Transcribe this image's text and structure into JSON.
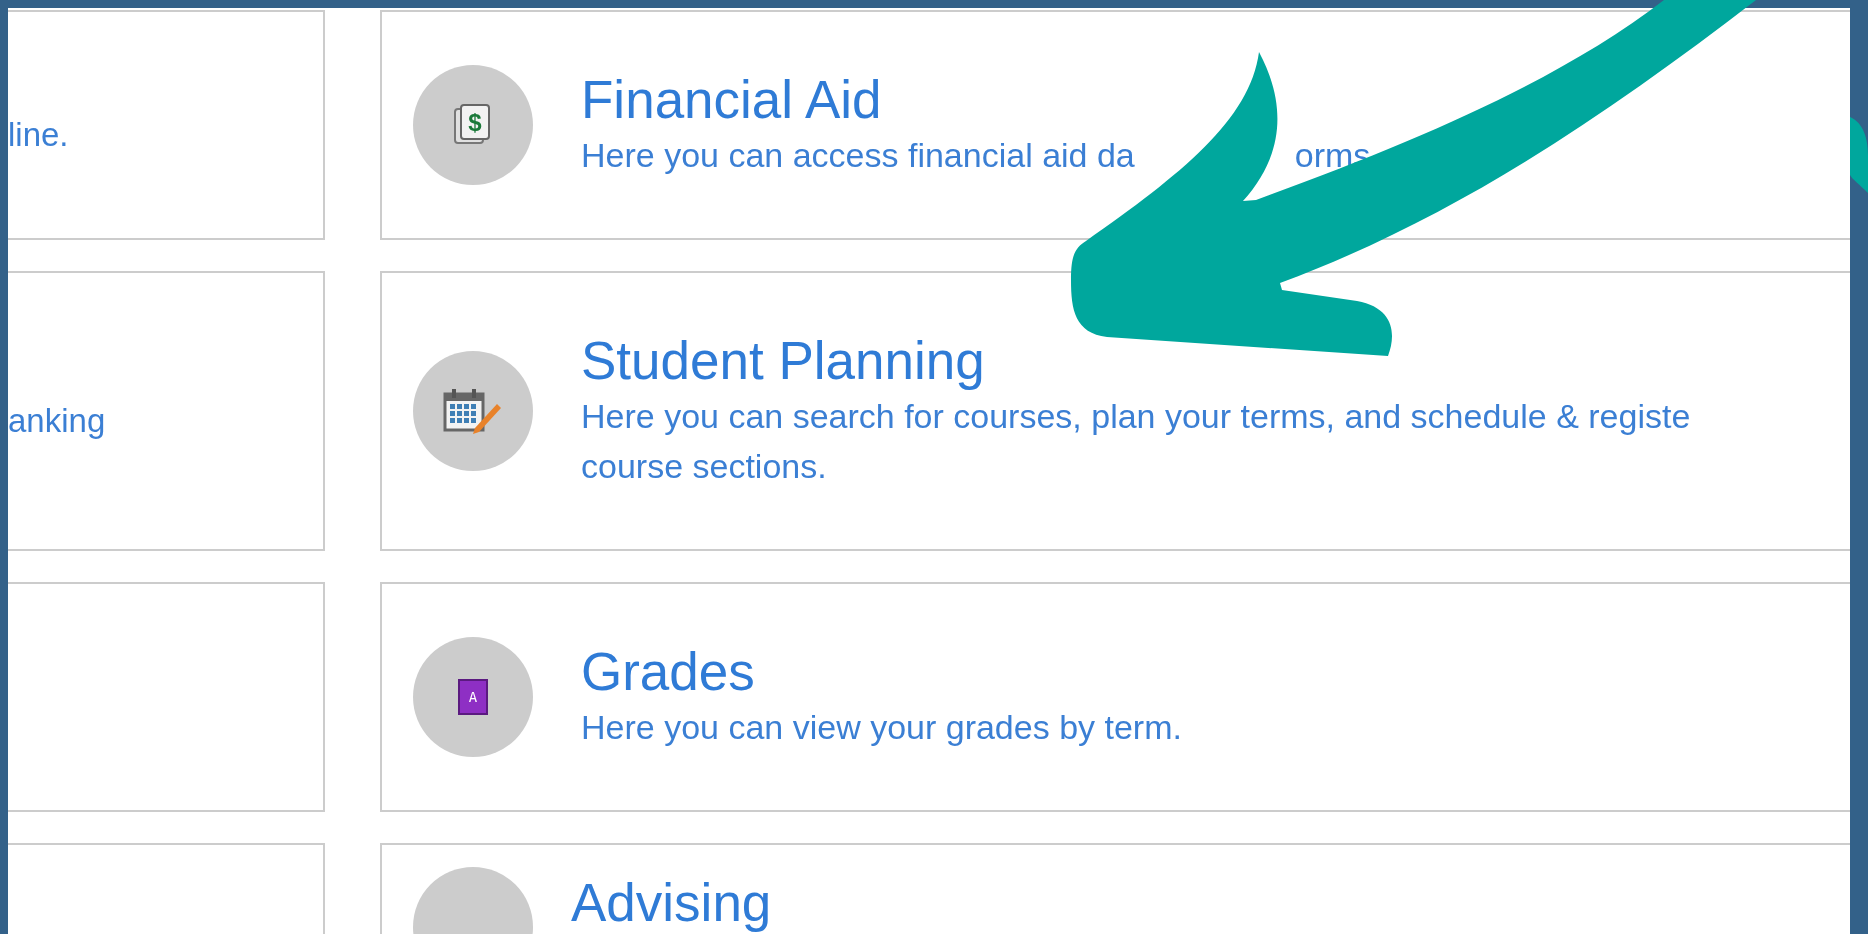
{
  "rows": [
    {
      "left_text": "line.",
      "icon": {
        "kind": "money",
        "label": "$"
      },
      "title": "Financial Aid",
      "description": [
        "Here you can access financial aid da",
        "orms"
      ]
    },
    {
      "left_text": "anking",
      "icon": {
        "kind": "calendar"
      },
      "title": "Student Planning",
      "description": [
        "Here you can search for courses, plan your terms, and schedule & registe",
        "course sections."
      ]
    },
    {
      "icon": {
        "kind": "grade",
        "label": "A"
      },
      "title": "Grades",
      "description": [
        "Here you can view your grades by term."
      ]
    },
    {
      "icon": {
        "kind": "blank"
      },
      "title": "Advising"
    }
  ]
}
